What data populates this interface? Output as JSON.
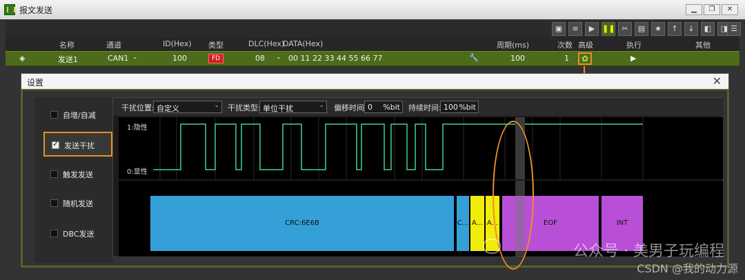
{
  "window": {
    "title": "报文发送",
    "min_btn": "▁",
    "restore_btn": "❐",
    "close_btn": "✕"
  },
  "toolbar": {
    "icons": [
      "save-icon",
      "list-icon",
      "play-icon",
      "pause-icon",
      "cut-icon",
      "paste-icon",
      "star-icon",
      "up-icon",
      "down-icon",
      "import-icon",
      "export-icon",
      "menu-icon"
    ]
  },
  "header": {
    "name": "名称",
    "channel": "通道",
    "id": "ID(Hex)",
    "type": "类型",
    "dlc": "DLC(Hex)",
    "data": "DATA(Hex)",
    "period": "周期(ms)",
    "count": "次数",
    "advanced": "高级",
    "execute": "执行",
    "other": "其他"
  },
  "row": {
    "name": "发送1",
    "channel": "CAN1",
    "id": "100",
    "type": "FD",
    "dlc": "08",
    "data": "00 11 22 33 44 55 66 77",
    "period": "100",
    "count": "1"
  },
  "dialog": {
    "title": "设置",
    "close": "✕",
    "sidebar": [
      {
        "label": "自增/自减",
        "checked": false
      },
      {
        "label": "发送干扰",
        "checked": true
      },
      {
        "label": "触发发送",
        "checked": false
      },
      {
        "label": "随机发送",
        "checked": false
      },
      {
        "label": "DBC发送",
        "checked": false
      }
    ],
    "controls": {
      "position_label": "干扰位置:",
      "position_value": "自定义",
      "type_label": "干扰类型:",
      "type_value": "单位干扰",
      "offset_label": "偏移时间:",
      "offset_value": "0",
      "offset_unit": "%bit",
      "duration_label": "持续时间:",
      "duration_value": "100",
      "duration_unit": "%bit"
    },
    "wave": {
      "high_label": "1:隐性",
      "low_label": "0:显性"
    },
    "segments": [
      {
        "label": "CRC:6E6B",
        "color": "#35a0d8"
      },
      {
        "label": "C...",
        "color": "#35a0d8"
      },
      {
        "label": "A...",
        "color": "#f2ec0a"
      },
      {
        "label": "A...",
        "color": "#f2ec0a"
      },
      {
        "label": "EOF",
        "color": "#b94fd6"
      },
      {
        "label": "INT",
        "color": "#b94fd6"
      }
    ]
  },
  "watermark": {
    "line1": "公众号 · 美男子玩编程",
    "line2": "CSDN @我的动力源"
  },
  "colors": {
    "accent": "#f08c2c",
    "row_green": "#4d6b1a",
    "crc_blue": "#35a0d8",
    "ack_yellow": "#f2ec0a",
    "eof_purple": "#b94fd6"
  }
}
